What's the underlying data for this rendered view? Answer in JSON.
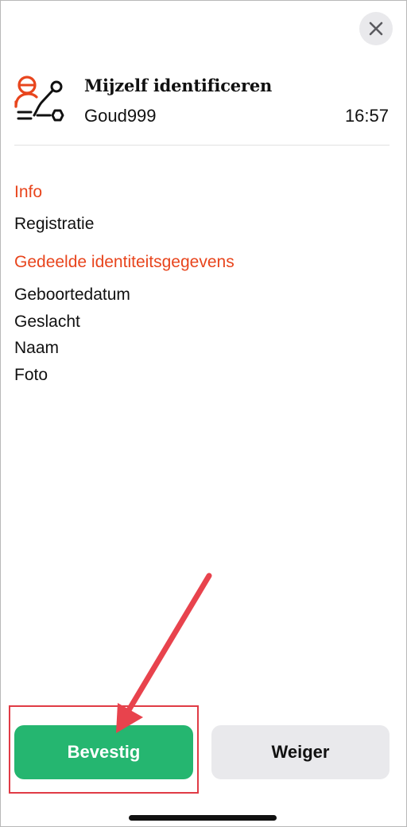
{
  "header": {
    "title": "Mijzelf identificeren",
    "subtitle": "Goud999",
    "time": "16:57",
    "icon": "identify-share-icon",
    "close_icon": "close-icon"
  },
  "info": {
    "heading": "Info",
    "value": "Registratie"
  },
  "shared": {
    "heading": "Gedeelde identiteitsgegevens",
    "items": [
      "Geboortedatum",
      "Geslacht",
      "Naam",
      "Foto"
    ]
  },
  "actions": {
    "confirm_label": "Bevestig",
    "reject_label": "Weiger"
  },
  "colors": {
    "accent": "#e8451d",
    "confirm": "#25b670",
    "secondary_button": "#e9e9ec",
    "annotation": "#e03b45"
  }
}
